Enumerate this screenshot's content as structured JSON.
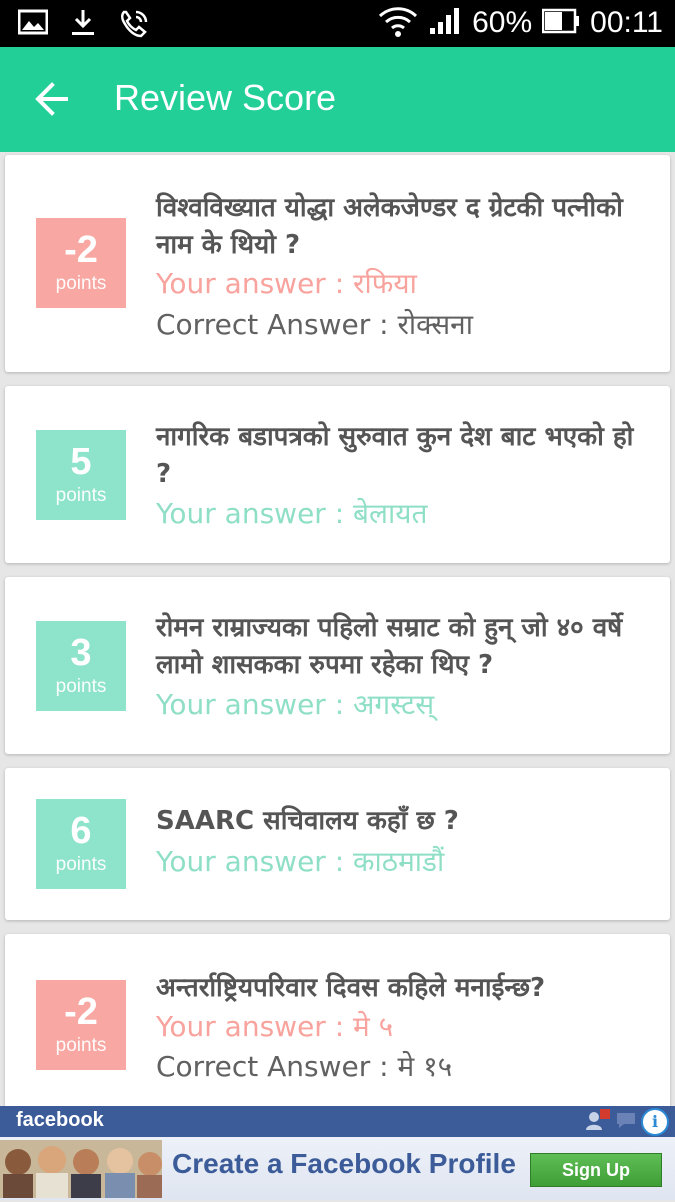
{
  "status_bar": {
    "battery": "60%",
    "time": "00:11",
    "icons": [
      "gallery-icon",
      "download-icon",
      "phone-wifi-icon",
      "wifi-icon",
      "signal-icon",
      "battery-icon"
    ]
  },
  "app_bar": {
    "title": "Review Score",
    "back_icon": "arrow-left-icon",
    "background": "#22cf97"
  },
  "results": [
    {
      "score": "-2",
      "points_label": "points",
      "status": "wrong",
      "question": "विश्वविख्यात योद्धा अलेकजेण्डर द ग्रेटकी पत्नीको नाम के थियो ?",
      "your_answer": "Your answer : रफिया",
      "correct_answer": "Correct Answer : रोक्सना"
    },
    {
      "score": "5",
      "points_label": "points",
      "status": "right",
      "question": "नागरिक बडापत्रको सुरुवात कुन देश बाट भएको हो ?",
      "your_answer": "Your answer : बेलायत"
    },
    {
      "score": "3",
      "points_label": "points",
      "status": "right",
      "question": "रोमन राम्राज्यका पहिलो सम्राट को हुन् जो ४० वर्षे लामो शासकका रुपमा रहेका थिए ?",
      "your_answer": "Your answer : अगस्टस्"
    },
    {
      "score": "6",
      "points_label": "points",
      "status": "right",
      "question": "SAARC सचिवालय कहाँ छ ?",
      "your_answer": "Your answer : काठमाडौं"
    },
    {
      "score": "-2",
      "points_label": "points",
      "status": "wrong",
      "question": "अन्तर्राष्ट्रियपरिवार दिवस कहिले मनाईन्छ?",
      "your_answer": "Your answer : मे ५",
      "correct_answer": "Correct Answer : मे १५"
    }
  ],
  "ad": {
    "brand": "facebook",
    "headline": "Create a Facebook Profile",
    "button": "Sign Up",
    "info_icon": "info-icon"
  },
  "colors": {
    "wrong": "#f8a7a2",
    "right": "#8ee3cb",
    "question_text": "#555555"
  }
}
